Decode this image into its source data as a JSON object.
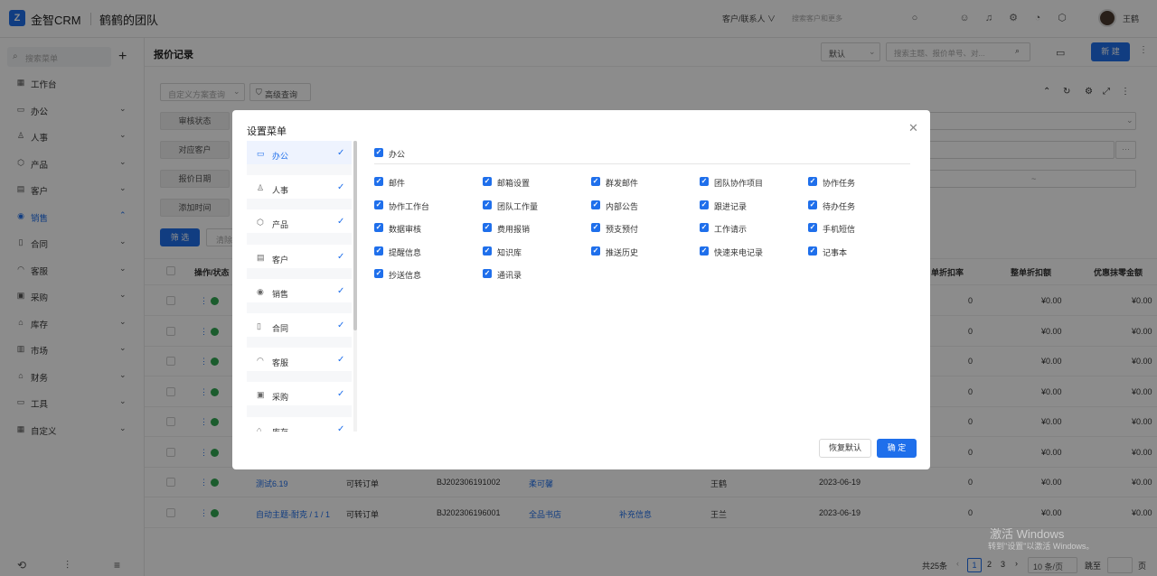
{
  "app": {
    "logo_letter": "Z",
    "name": "金智CRM",
    "team": "鹤鹤的团队"
  },
  "topbar": {
    "search_scope": "客户/联系人 ∨",
    "search_placeholder": "搜索客户和更多",
    "user_name": "王鹤"
  },
  "sidebar": {
    "search_placeholder": "搜索菜单",
    "items": [
      {
        "label": "工作台",
        "icon": "dashboard-icon",
        "glyph": "▦",
        "chevron": ""
      },
      {
        "label": "办公",
        "icon": "office-icon",
        "glyph": "▭",
        "chevron": "⌄"
      },
      {
        "label": "人事",
        "icon": "person-icon",
        "glyph": "♙",
        "chevron": "⌄"
      },
      {
        "label": "产品",
        "icon": "product-icon",
        "glyph": "⬡",
        "chevron": "⌄"
      },
      {
        "label": "客户",
        "icon": "customer-icon",
        "glyph": "▤",
        "chevron": "⌄"
      },
      {
        "label": "销售",
        "icon": "sales-icon",
        "glyph": "◉",
        "chevron": "⌃"
      },
      {
        "label": "合同",
        "icon": "contract-icon",
        "glyph": "▯",
        "chevron": "⌄"
      },
      {
        "label": "客服",
        "icon": "service-icon",
        "glyph": "◠",
        "chevron": "⌄"
      },
      {
        "label": "采购",
        "icon": "purchase-icon",
        "glyph": "▣",
        "chevron": "⌄"
      },
      {
        "label": "库存",
        "icon": "stock-icon",
        "glyph": "⌂",
        "chevron": "⌄"
      },
      {
        "label": "市场",
        "icon": "market-icon",
        "glyph": "▥",
        "chevron": "⌄"
      },
      {
        "label": "财务",
        "icon": "finance-icon",
        "glyph": "⌂",
        "chevron": "⌄"
      },
      {
        "label": "工具",
        "icon": "tool-icon",
        "glyph": "▭",
        "chevron": "⌄"
      },
      {
        "label": "自定义",
        "icon": "custom-icon",
        "glyph": "▦",
        "chevron": "⌄"
      }
    ]
  },
  "page": {
    "title": "报价记录",
    "view_select": "默认",
    "search_placeholder": "搜索主题、报价单号、对...",
    "new_button": "新 建",
    "scheme_placeholder": "自定义方案查询",
    "advanced_query": "高级查询",
    "filters": [
      "审核状态",
      "对应客户",
      "报价日期",
      "添加时间"
    ],
    "filter_button": "筛 选",
    "clear_button": "清除",
    "headers": {
      "ops": "操作/状态",
      "discount_rate": "单折扣率",
      "discount_amt": "整单折扣额",
      "wipe_amt": "优惠抹零金额"
    },
    "rows": [
      {
        "rate": "0",
        "amt": "¥0.00",
        "wipe": "¥0.00"
      },
      {
        "rate": "0",
        "amt": "¥0.00",
        "wipe": "¥0.00"
      },
      {
        "rate": "0",
        "amt": "¥0.00",
        "wipe": "¥0.00"
      },
      {
        "rate": "0",
        "amt": "¥0.00",
        "wipe": "¥0.00"
      },
      {
        "rate": "0",
        "amt": "¥0.00",
        "wipe": "¥0.00"
      },
      {
        "rate": "0",
        "amt": "¥0.00",
        "wipe": "¥0.00"
      },
      {
        "subject": "测试6.19",
        "status": "可转订单",
        "no": "BJ202306191002",
        "customer": "柔可馨",
        "contact": "",
        "owner": "王鹤",
        "date": "2023-06-19",
        "rate": "0",
        "amt": "¥0.00",
        "wipe": "¥0.00"
      },
      {
        "subject": "自动主题-耐克 / 1 / 1",
        "status": "可转订单",
        "no": "BJ202306196001",
        "customer": "全品书店",
        "contact": "补充信息",
        "owner": "王兰",
        "date": "2023-06-19",
        "rate": "0",
        "amt": "¥0.00",
        "wipe": "¥0.00"
      }
    ],
    "pagination": {
      "total": "共25条",
      "pages": [
        "1",
        "2",
        "3"
      ],
      "page_size": "10 条/页",
      "jump": "跳至",
      "page_unit": "页"
    }
  },
  "watermark": {
    "line1": "激活 Windows",
    "line2": "转到\"设置\"以激活 Windows。"
  },
  "modal": {
    "title": "设置菜单",
    "menu": [
      {
        "label": "办公",
        "icon": "office-icon",
        "glyph": "▭"
      },
      {
        "label": "人事",
        "icon": "person-icon",
        "glyph": "♙"
      },
      {
        "label": "产品",
        "icon": "product-icon",
        "glyph": "⬡"
      },
      {
        "label": "客户",
        "icon": "customer-icon",
        "glyph": "▤"
      },
      {
        "label": "销售",
        "icon": "sales-icon",
        "glyph": "◉"
      },
      {
        "label": "合同",
        "icon": "contract-icon",
        "glyph": "▯"
      },
      {
        "label": "客服",
        "icon": "service-icon",
        "glyph": "◠"
      },
      {
        "label": "采购",
        "icon": "purchase-icon",
        "glyph": "▣"
      },
      {
        "label": "库存",
        "icon": "stock-icon",
        "glyph": "⌂"
      }
    ],
    "group_label": "办公",
    "options": [
      "邮件",
      "邮箱设置",
      "群发邮件",
      "团队协作项目",
      "协作任务",
      "协作工作台",
      "团队工作量",
      "内部公告",
      "跟进记录",
      "待办任务",
      "数据审核",
      "费用报销",
      "预支预付",
      "工作请示",
      "手机短信",
      "提醒信息",
      "知识库",
      "推送历史",
      "快速来电记录",
      "记事本",
      "抄送信息",
      "通讯录"
    ],
    "restore_button": "恢复默认",
    "ok_button": "确 定"
  }
}
